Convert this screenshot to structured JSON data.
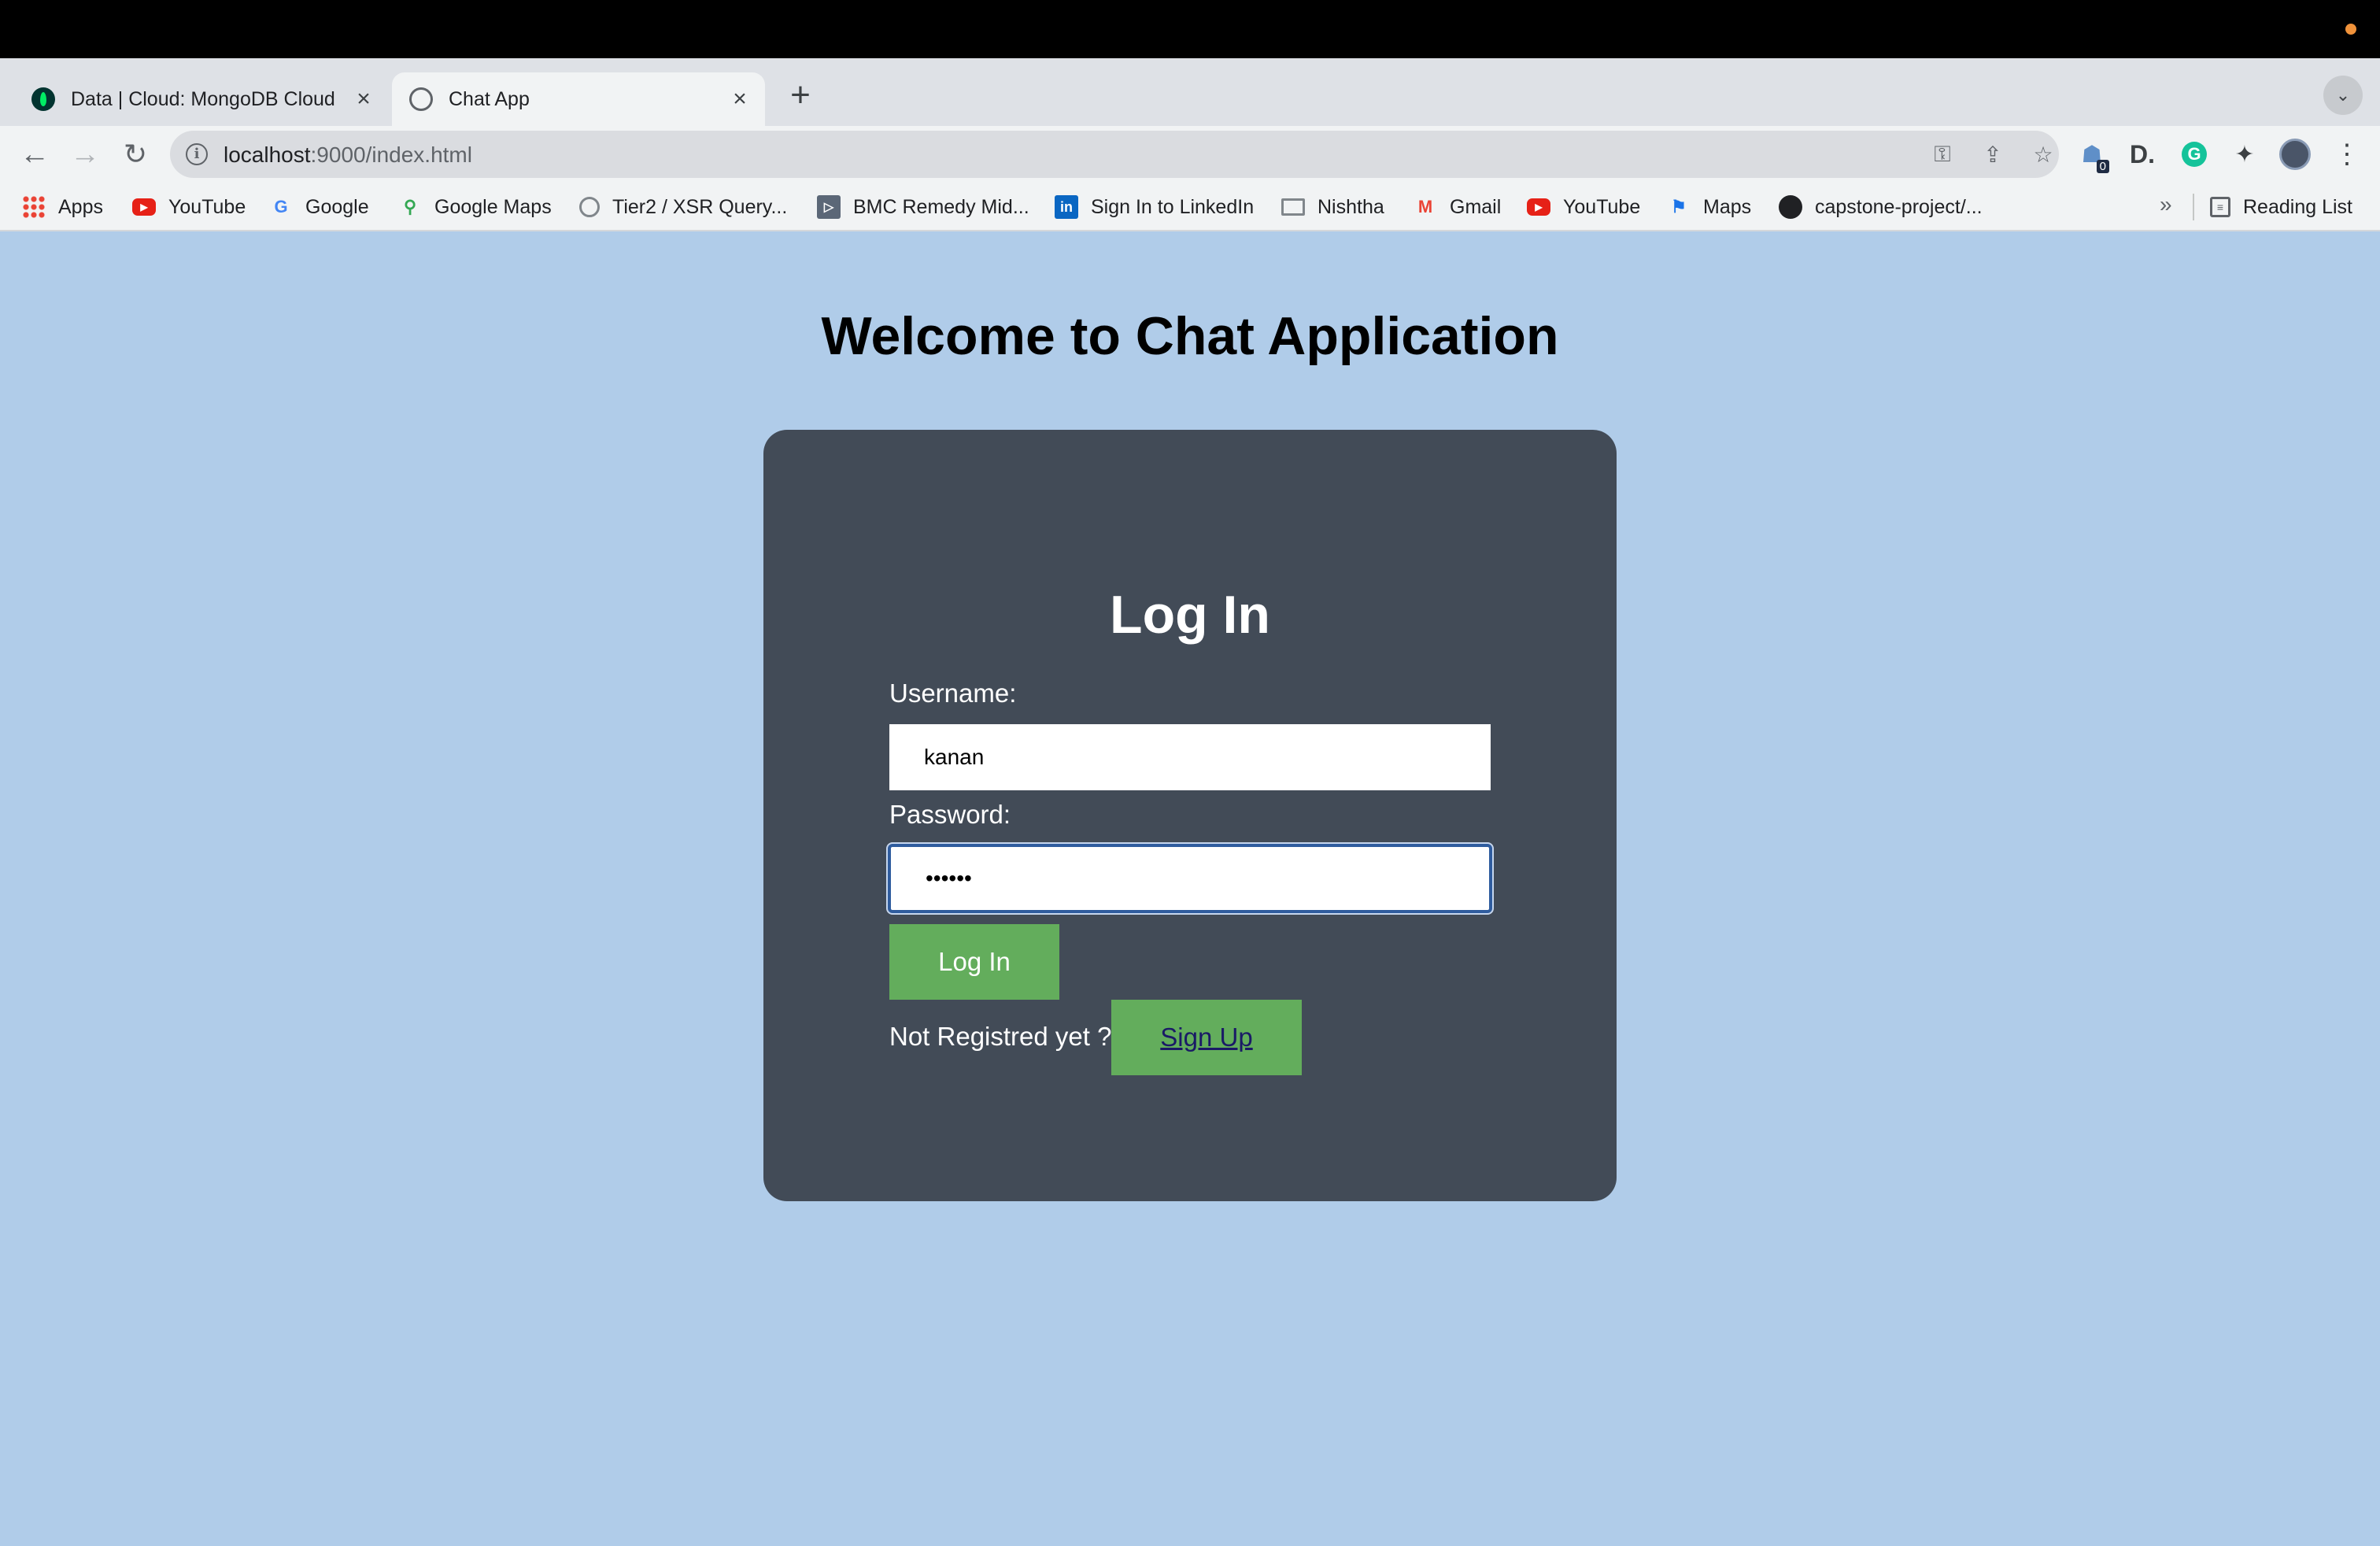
{
  "browser": {
    "tabs": [
      {
        "title": "Data | Cloud: MongoDB Cloud",
        "icon": "mongodb-leaf-icon"
      },
      {
        "title": "Chat App",
        "icon": "globe-icon"
      }
    ],
    "url_host": "localhost",
    "url_path": ":9000/index.html",
    "extension_badge": "0",
    "bookmarks": [
      {
        "label": "Apps",
        "icon": "apps-grid-icon"
      },
      {
        "label": "YouTube",
        "icon": "youtube-icon"
      },
      {
        "label": "Google",
        "icon": "google-icon"
      },
      {
        "label": "Google Maps",
        "icon": "google-maps-icon"
      },
      {
        "label": "Tier2 / XSR Query...",
        "icon": "globe-icon"
      },
      {
        "label": "BMC Remedy Mid...",
        "icon": "bmc-icon"
      },
      {
        "label": "Sign In to LinkedIn",
        "icon": "linkedin-icon"
      },
      {
        "label": "Nishtha",
        "icon": "folder-icon"
      },
      {
        "label": "Gmail",
        "icon": "gmail-icon"
      },
      {
        "label": "YouTube",
        "icon": "youtube-icon"
      },
      {
        "label": "Maps",
        "icon": "maps-icon"
      },
      {
        "label": "capstone-project/...",
        "icon": "github-icon"
      }
    ],
    "more_bookmarks": "»",
    "reading_list": "Reading List"
  },
  "page": {
    "heading": "Welcome to Chat Application",
    "form": {
      "title": "Log In",
      "username_label": "Username:",
      "username_value": "kanan",
      "password_label": "Password:",
      "password_value": "••••••",
      "login_button": "Log In",
      "not_registered_text": "Not Registred yet ?",
      "signup_button": "Sign Up"
    }
  },
  "colors": {
    "page_background": "#b0cce9",
    "card_background": "#424b57",
    "button_green": "#63ad5c"
  }
}
